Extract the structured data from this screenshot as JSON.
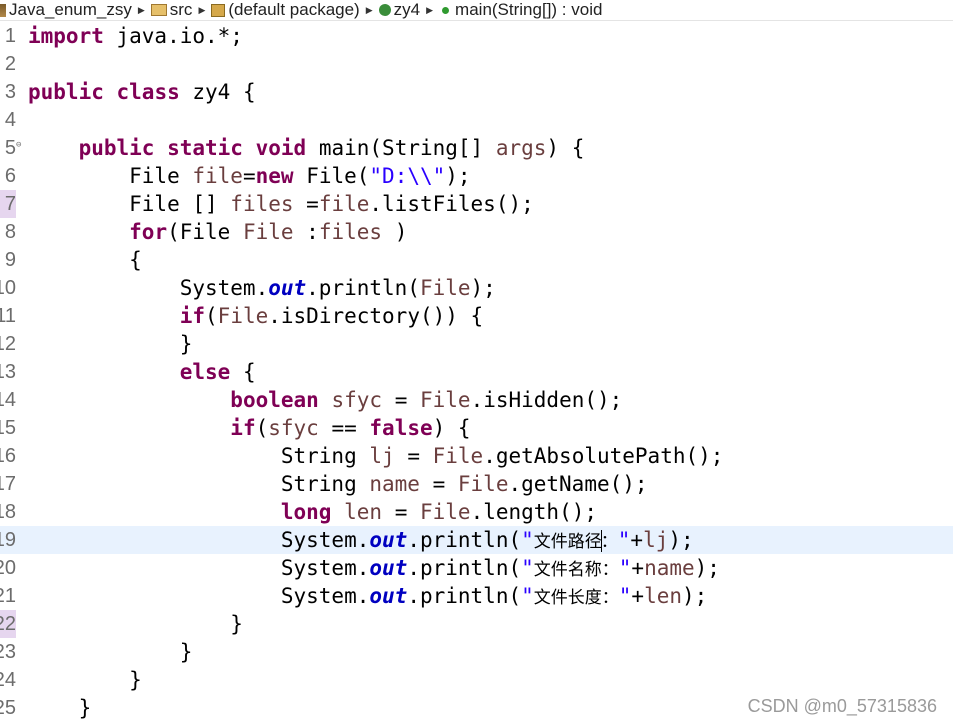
{
  "breadcrumb": [
    {
      "label": "Java_enum_zsy",
      "icon": "project-icon"
    },
    {
      "label": "src",
      "icon": "source-folder-icon"
    },
    {
      "label": "(default package)",
      "icon": "package-icon"
    },
    {
      "label": "zy4",
      "icon": "class-icon"
    },
    {
      "label": "main(String[]) : void",
      "icon": "method-icon"
    }
  ],
  "editor": {
    "highlighted_line": "19",
    "lines": [
      {
        "num": "1",
        "tokens": [
          [
            "kw",
            "import"
          ],
          [
            "p",
            " java.io.*;"
          ]
        ]
      },
      {
        "num": "2",
        "tokens": []
      },
      {
        "num": "3",
        "tokens": [
          [
            "kw",
            "public"
          ],
          [
            "p",
            " "
          ],
          [
            "kw",
            "class"
          ],
          [
            "p",
            " zy4 {"
          ]
        ]
      },
      {
        "num": "4",
        "tokens": []
      },
      {
        "num": "5",
        "fold": true,
        "tokens": [
          [
            "p",
            "    "
          ],
          [
            "kw",
            "public"
          ],
          [
            "p",
            " "
          ],
          [
            "kw",
            "static"
          ],
          [
            "p",
            " "
          ],
          [
            "kw",
            "void"
          ],
          [
            "p",
            " main(String[] "
          ],
          [
            "var",
            "args"
          ],
          [
            "p",
            ") {"
          ]
        ]
      },
      {
        "num": "6",
        "tokens": [
          [
            "p",
            "        File "
          ],
          [
            "var",
            "file"
          ],
          [
            "p",
            "="
          ],
          [
            "kw",
            "new"
          ],
          [
            "p",
            " File("
          ],
          [
            "str",
            "\"D:\\\\\""
          ],
          [
            "p",
            ");"
          ]
        ]
      },
      {
        "num": "7",
        "mark": true,
        "tokens": [
          [
            "p",
            "        File [] "
          ],
          [
            "var",
            "files"
          ],
          [
            "p",
            " ="
          ],
          [
            "var",
            "file"
          ],
          [
            "p",
            ".listFiles();"
          ]
        ]
      },
      {
        "num": "8",
        "tokens": [
          [
            "p",
            "        "
          ],
          [
            "kw",
            "for"
          ],
          [
            "p",
            "(File "
          ],
          [
            "var",
            "File"
          ],
          [
            "p",
            " :"
          ],
          [
            "var",
            "files"
          ],
          [
            "p",
            " )"
          ]
        ]
      },
      {
        "num": "9",
        "tokens": [
          [
            "p",
            "        {"
          ]
        ]
      },
      {
        "num": "10",
        "tokens": [
          [
            "p",
            "            System."
          ],
          [
            "fld",
            "out"
          ],
          [
            "p",
            ".println("
          ],
          [
            "var",
            "File"
          ],
          [
            "p",
            ");"
          ]
        ]
      },
      {
        "num": "11",
        "tokens": [
          [
            "p",
            "            "
          ],
          [
            "kw",
            "if"
          ],
          [
            "p",
            "("
          ],
          [
            "var",
            "File"
          ],
          [
            "p",
            ".isDirectory()) {"
          ]
        ]
      },
      {
        "num": "12",
        "tokens": [
          [
            "p",
            "            }"
          ]
        ]
      },
      {
        "num": "13",
        "tokens": [
          [
            "p",
            "            "
          ],
          [
            "kw",
            "else"
          ],
          [
            "p",
            " {"
          ]
        ]
      },
      {
        "num": "14",
        "tokens": [
          [
            "p",
            "                "
          ],
          [
            "kw",
            "boolean"
          ],
          [
            "p",
            " "
          ],
          [
            "var",
            "sfyc"
          ],
          [
            "p",
            " = "
          ],
          [
            "var",
            "File"
          ],
          [
            "p",
            ".isHidden();"
          ]
        ]
      },
      {
        "num": "15",
        "tokens": [
          [
            "p",
            "                "
          ],
          [
            "kw",
            "if"
          ],
          [
            "p",
            "("
          ],
          [
            "var",
            "sfyc"
          ],
          [
            "p",
            " == "
          ],
          [
            "kw",
            "false"
          ],
          [
            "p",
            ") {"
          ]
        ]
      },
      {
        "num": "16",
        "tokens": [
          [
            "p",
            "                    String "
          ],
          [
            "var",
            "lj"
          ],
          [
            "p",
            " = "
          ],
          [
            "var",
            "File"
          ],
          [
            "p",
            ".getAbsolutePath();"
          ]
        ]
      },
      {
        "num": "17",
        "tokens": [
          [
            "p",
            "                    String "
          ],
          [
            "var",
            "name"
          ],
          [
            "p",
            " = "
          ],
          [
            "var",
            "File"
          ],
          [
            "p",
            ".getName();"
          ]
        ]
      },
      {
        "num": "18",
        "tokens": [
          [
            "p",
            "                    "
          ],
          [
            "kw",
            "long"
          ],
          [
            "p",
            " "
          ],
          [
            "var",
            "len"
          ],
          [
            "p",
            " = "
          ],
          [
            "var",
            "File"
          ],
          [
            "p",
            ".length();"
          ]
        ]
      },
      {
        "num": "19",
        "tokens": [
          [
            "p",
            "                    System."
          ],
          [
            "fld",
            "out"
          ],
          [
            "p",
            ".println("
          ],
          [
            "str",
            "\""
          ],
          [
            "cjk",
            "文件路径"
          ],
          [
            "caret",
            ""
          ],
          [
            "cjk",
            "："
          ],
          [
            "str",
            "\""
          ],
          [
            "p",
            "+"
          ],
          [
            "var",
            "lj"
          ],
          [
            "p",
            ");"
          ]
        ]
      },
      {
        "num": "20",
        "tokens": [
          [
            "p",
            "                    System."
          ],
          [
            "fld",
            "out"
          ],
          [
            "p",
            ".println("
          ],
          [
            "str",
            "\""
          ],
          [
            "cjk",
            "文件名称："
          ],
          [
            "str",
            "\""
          ],
          [
            "p",
            "+"
          ],
          [
            "var",
            "name"
          ],
          [
            "p",
            ");"
          ]
        ]
      },
      {
        "num": "21",
        "tokens": [
          [
            "p",
            "                    System."
          ],
          [
            "fld",
            "out"
          ],
          [
            "p",
            ".println("
          ],
          [
            "str",
            "\""
          ],
          [
            "cjk",
            "文件长度："
          ],
          [
            "str",
            "\""
          ],
          [
            "p",
            "+"
          ],
          [
            "var",
            "len"
          ],
          [
            "p",
            ");"
          ]
        ]
      },
      {
        "num": "22",
        "mark": true,
        "tokens": [
          [
            "p",
            "                }"
          ]
        ]
      },
      {
        "num": "23",
        "tokens": [
          [
            "p",
            "            }"
          ]
        ]
      },
      {
        "num": "24",
        "tokens": [
          [
            "p",
            "        }"
          ]
        ]
      },
      {
        "num": "25",
        "tokens": [
          [
            "p",
            "    }"
          ]
        ]
      }
    ]
  },
  "watermark": "CSDN @m0_57315836",
  "colors": {
    "keyword": "#7f0055",
    "string": "#2a00ff",
    "field": "#0000c0",
    "variable": "#6a3e3e",
    "current_line": "#e8f2fe"
  }
}
